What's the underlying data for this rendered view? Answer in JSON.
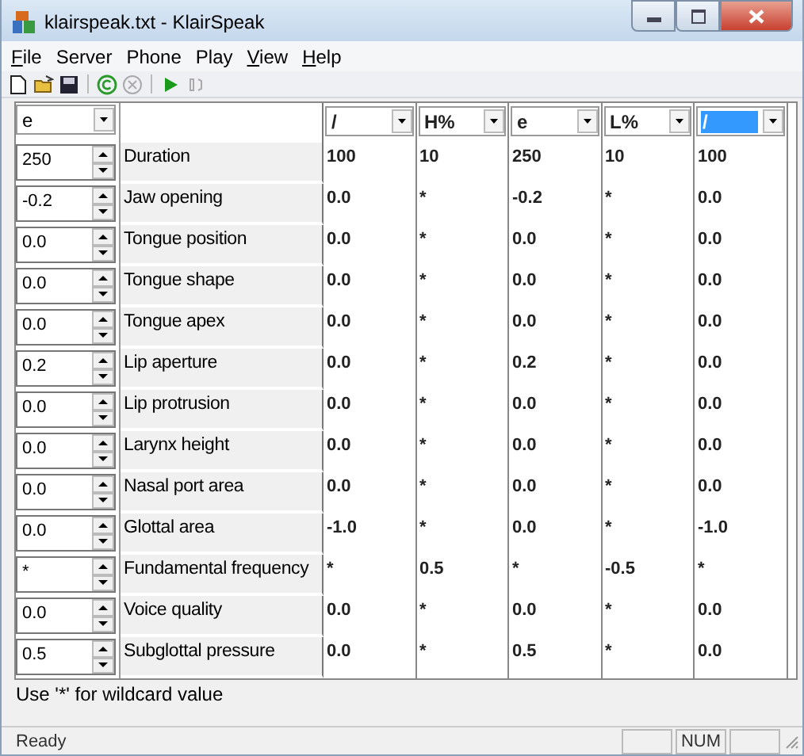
{
  "window": {
    "title": "klairspeak.txt - KlairSpeak"
  },
  "menu": [
    {
      "label": "File",
      "underlined": true
    },
    {
      "label": "Server",
      "underlined": false
    },
    {
      "label": "Phone",
      "underlined": false
    },
    {
      "label": "Play",
      "underlined": false
    },
    {
      "label": "View",
      "underlined": true
    },
    {
      "label": "Help",
      "underlined": true
    }
  ],
  "toolbar": [
    {
      "kind": "new"
    },
    {
      "kind": "open"
    },
    {
      "kind": "save"
    },
    {
      "kind": "sep"
    },
    {
      "kind": "connect"
    },
    {
      "kind": "disconnect"
    },
    {
      "kind": "sep"
    },
    {
      "kind": "play"
    },
    {
      "kind": "stop"
    }
  ],
  "phone_selector": {
    "value": "e",
    "selected": false
  },
  "columns": [
    {
      "value": "/",
      "selected": false
    },
    {
      "value": "H%",
      "selected": false
    },
    {
      "value": "e",
      "selected": false
    },
    {
      "value": "L%",
      "selected": false
    },
    {
      "value": "/",
      "selected": true
    }
  ],
  "rows": [
    {
      "label": "Duration",
      "current": "250",
      "values": [
        "100",
        "10",
        "250",
        "10",
        "100"
      ]
    },
    {
      "label": "Jaw opening",
      "current": "-0.2",
      "values": [
        "0.0",
        "*",
        "-0.2",
        "*",
        "0.0"
      ]
    },
    {
      "label": "Tongue position",
      "current": "0.0",
      "values": [
        "0.0",
        "*",
        "0.0",
        "*",
        "0.0"
      ]
    },
    {
      "label": "Tongue shape",
      "current": "0.0",
      "values": [
        "0.0",
        "*",
        "0.0",
        "*",
        "0.0"
      ]
    },
    {
      "label": "Tongue apex",
      "current": "0.0",
      "values": [
        "0.0",
        "*",
        "0.0",
        "*",
        "0.0"
      ]
    },
    {
      "label": "Lip aperture",
      "current": "0.2",
      "values": [
        "0.0",
        "*",
        "0.2",
        "*",
        "0.0"
      ]
    },
    {
      "label": "Lip protrusion",
      "current": "0.0",
      "values": [
        "0.0",
        "*",
        "0.0",
        "*",
        "0.0"
      ]
    },
    {
      "label": "Larynx height",
      "current": "0.0",
      "values": [
        "0.0",
        "*",
        "0.0",
        "*",
        "0.0"
      ]
    },
    {
      "label": "Nasal port area",
      "current": "0.0",
      "values": [
        "0.0",
        "*",
        "0.0",
        "*",
        "0.0"
      ]
    },
    {
      "label": "Glottal area",
      "current": "0.0",
      "values": [
        "-1.0",
        "*",
        "0.0",
        "*",
        "-1.0"
      ]
    },
    {
      "label": "Fundamental frequency",
      "current": "*",
      "values": [
        "*",
        "0.5",
        "*",
        "-0.5",
        "*"
      ]
    },
    {
      "label": "Voice quality",
      "current": "0.0",
      "values": [
        "0.0",
        "*",
        "0.0",
        "*",
        "0.0"
      ]
    },
    {
      "label": "Subglottal pressure",
      "current": "0.5",
      "values": [
        "0.0",
        "*",
        "0.5",
        "*",
        "0.0"
      ]
    }
  ],
  "hint": "Use '*' for wildcard value",
  "status_bar": {
    "text": "Ready",
    "panels": [
      {
        "kind": "blank"
      },
      {
        "kind": "text",
        "text": "NUM"
      },
      {
        "kind": "blank"
      }
    ]
  }
}
